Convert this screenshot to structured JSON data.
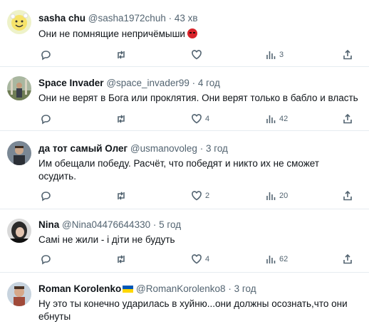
{
  "posts": [
    {
      "name": "sasha chu",
      "handle": "@sasha1972chuh",
      "sep": "·",
      "time": "43 хв",
      "text": "Они не помнящие непричёмыши",
      "text_emoji": "angry-face-icon",
      "reply_count": "",
      "retweet_count": "",
      "like_count": "",
      "views": "3",
      "avatar_color": "#f2e9a6"
    },
    {
      "name": "Space Invader",
      "handle": "@space_invader99",
      "sep": "·",
      "time": "4 год",
      "text": "Они не верят в Бога или проклятия. Они верят только в бабло и власть",
      "reply_count": "",
      "retweet_count": "",
      "like_count": "4",
      "views": "42",
      "avatar_color": "#7d8b6a"
    },
    {
      "name": "да тот самый Олег",
      "handle": "@usmanovoleg",
      "sep": "·",
      "time": "3 год",
      "text": "Им обещали победу. Расчёт, что победят и никто их не сможет осудить.",
      "reply_count": "",
      "retweet_count": "",
      "like_count": "2",
      "views": "20",
      "avatar_color": "#8a96a3"
    },
    {
      "name": "Nina",
      "handle": "@Nina04476644330",
      "sep": "·",
      "time": "5 год",
      "text": "Самі не жили - і діти не будуть",
      "reply_count": "",
      "retweet_count": "",
      "like_count": "4",
      "views": "62",
      "avatar_color": "#4a4a4a"
    },
    {
      "name": "Roman Korolenko",
      "handle": "@RomanKorolenko8",
      "sep": "·",
      "time": "3 год",
      "text": "Ну это ты конечно ударилась в хуйню...они должны осознать,что они ебнуты",
      "avatar_color": "#b08a6a",
      "flag": "ukraine-flag-icon"
    }
  ],
  "colors": {
    "text": "#0f1419",
    "secondary": "#536471",
    "divider": "#e6ecf0"
  }
}
